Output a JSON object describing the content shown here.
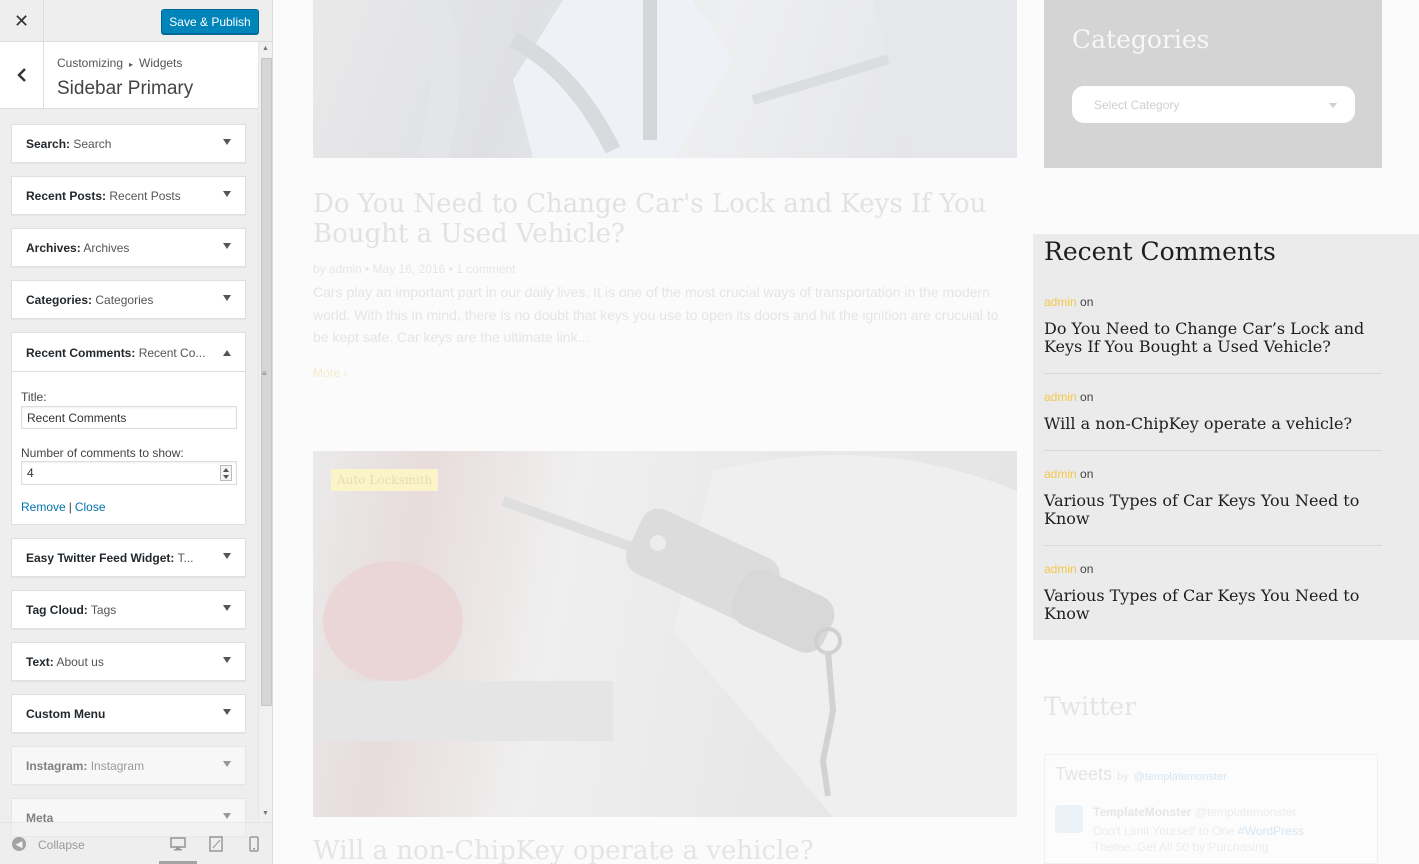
{
  "customizer": {
    "close_label": "✕",
    "publish_label": "Save & Publish",
    "breadcrumb": {
      "parent": "Customizing",
      "separator": "▸",
      "current": "Widgets"
    },
    "section_title": "Sidebar Primary",
    "widgets": [
      {
        "type": "Search:",
        "title": "Search"
      },
      {
        "type": "Recent Posts:",
        "title": "Recent Posts"
      },
      {
        "type": "Archives:",
        "title": "Archives"
      },
      {
        "type": "Categories:",
        "title": "Categories"
      }
    ],
    "expanded_widget": {
      "type": "Recent Comments:",
      "title": "Recent Co...",
      "title_label": "Title:",
      "title_value": "Recent Comments",
      "number_label": "Number of comments to show:",
      "number_value": "4",
      "remove_label": "Remove",
      "close_label": "Close",
      "pipe": "|"
    },
    "widgets_after": [
      {
        "type": "Easy Twitter Feed Widget:",
        "title": "T..."
      },
      {
        "type": "Tag Cloud:",
        "title": "Tags"
      },
      {
        "type": "Text:",
        "title": "About us"
      },
      {
        "type": "Custom Menu",
        "title": ""
      },
      {
        "type": "Instagram:",
        "title": "Instagram"
      },
      {
        "type": "Meta",
        "title": ""
      }
    ],
    "footer": {
      "collapse_label": "Collapse"
    }
  },
  "preview": {
    "post1": {
      "title": "Do You Need to Change Car's Lock and Keys If You Bought a Used Vehicle?",
      "meta": "by admin  •  May 16, 2016  •  1 comment",
      "excerpt": "Cars play an important part in our daily lives. It is one of the most crucial ways of transportation in the modern world. With this in mind, there is no doubt that keys you use to open its doors and hit the ignition are crucuial to be kept safe. Car keys are the ultimate link...",
      "more": "More ›"
    },
    "post2": {
      "category": "Auto Locksmith",
      "title": "Will a non-ChipKey operate a vehicle?"
    },
    "categories_widget": {
      "title": "Categories",
      "select_placeholder": "Select Category"
    },
    "recent_comments": {
      "heading": "Recent Comments",
      "items": [
        {
          "author": "admin",
          "on": " on",
          "post": "Do You Need to Change Car’s Lock and Keys If You Bought a Used Vehicle?"
        },
        {
          "author": "admin",
          "on": " on",
          "post": "Will a non-ChipKey operate a vehicle?"
        },
        {
          "author": "admin",
          "on": " on",
          "post": "Various Types of Car Keys You Need to Know"
        },
        {
          "author": "admin",
          "on": " on",
          "post": "Various Types of Car Keys You Need to Know"
        }
      ]
    },
    "twitter": {
      "title": "Twitter",
      "tweets_label": "Tweets",
      "by": "by",
      "handle": "@templatemonster",
      "name": "TemplateMonster",
      "user_handle": "@templatemonster",
      "text": "Don't Limit Yourself to One",
      "text_link": "#WordPress",
      "text2": "Theme. Get All 50 by Purchasing"
    }
  },
  "colors": {
    "publish_blue": "#0085ba",
    "link_blue": "#0073aa",
    "author_yellow": "#f2c94c"
  }
}
